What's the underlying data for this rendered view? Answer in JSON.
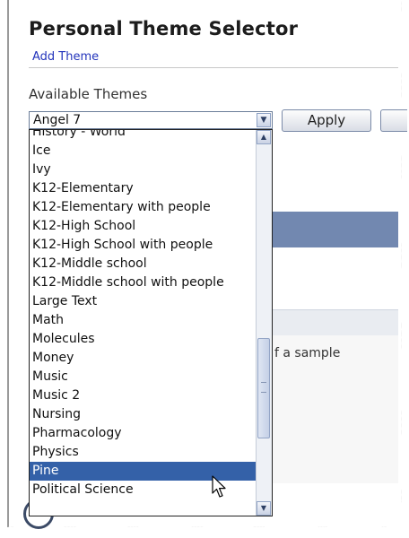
{
  "page": {
    "title": "Personal Theme Selector",
    "add_theme_link": "Add Theme",
    "available_label": "Available Themes",
    "sample_text": "f a sample"
  },
  "theme_select": {
    "value": "Angel 7",
    "apply_label": "Apply",
    "options": [
      "History - World",
      "Ice",
      "Ivy",
      "K12-Elementary",
      "K12-Elementary with people",
      "K12-High School",
      "K12-High School with people",
      "K12-Middle school",
      "K12-Middle school with people",
      "Large Text",
      "Math",
      "Molecules",
      "Money",
      "Music",
      "Music 2",
      "Nursing",
      "Pharmacology",
      "Physics",
      "Pine",
      "Political Science"
    ],
    "highlighted": "Pine"
  },
  "icons": {
    "select_arrow": "chevron-down-icon",
    "scroll_up": "chevron-up-icon",
    "scroll_down": "chevron-down-icon",
    "cursor": "mouse-pointer-icon"
  },
  "colors": {
    "selection": "#3461a8",
    "link": "#2233bb",
    "band": "#7288b0"
  }
}
